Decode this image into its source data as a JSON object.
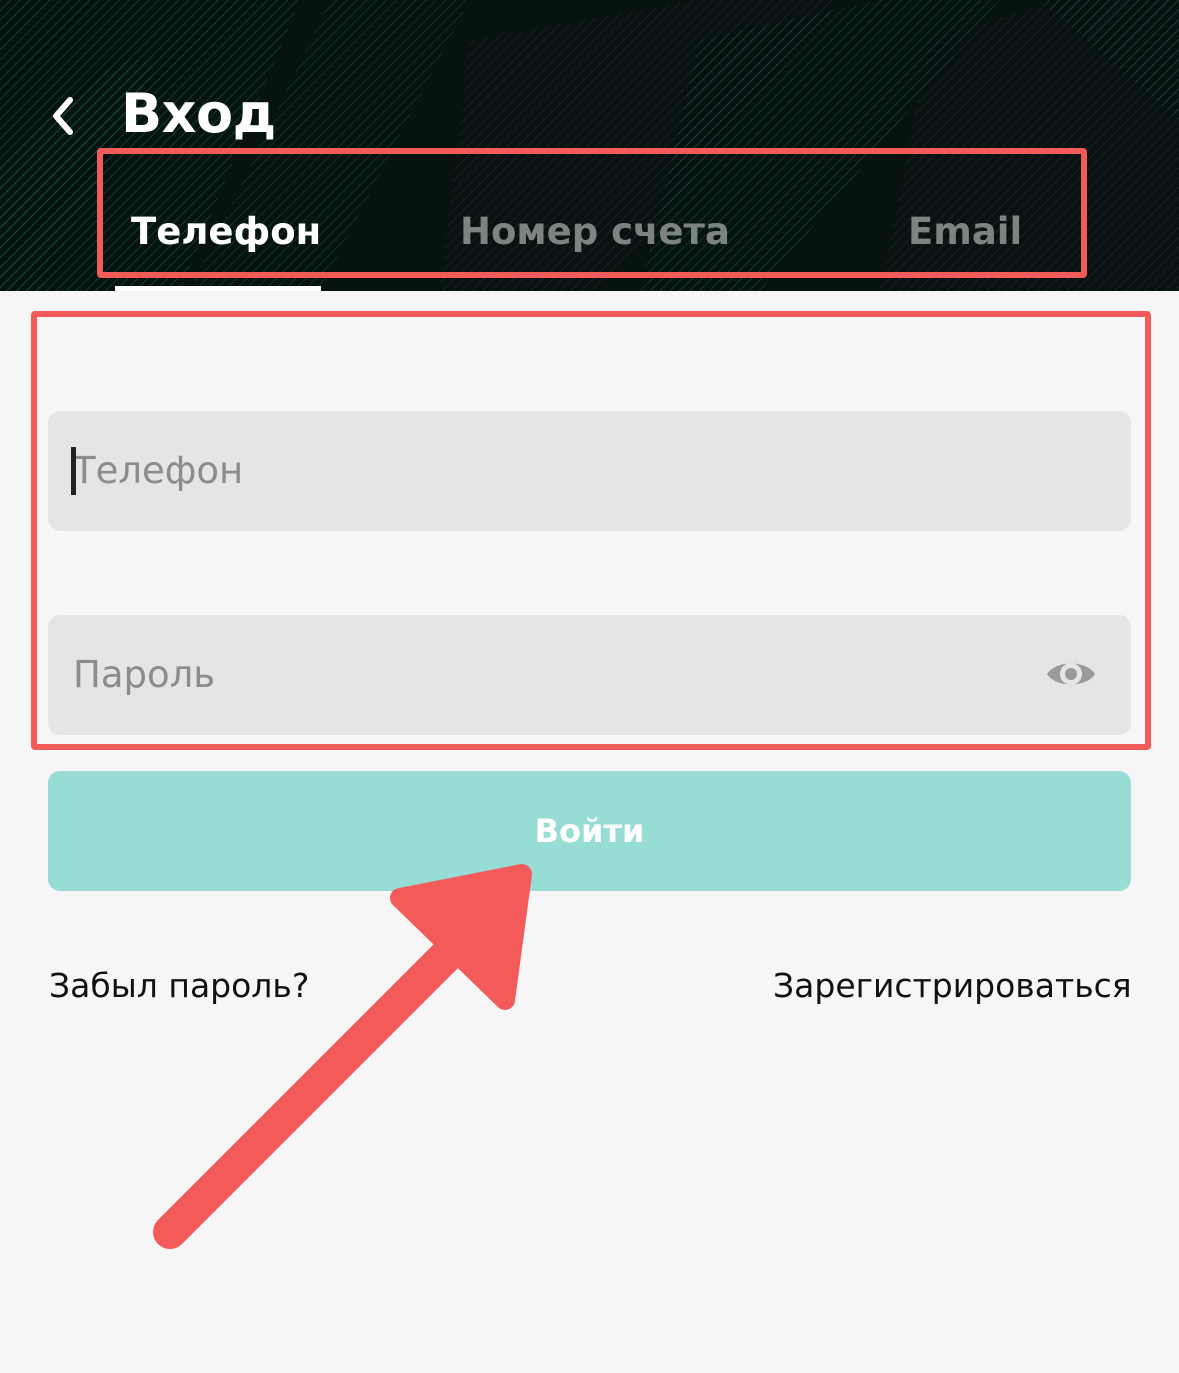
{
  "header": {
    "title": "Вход",
    "back_icon": "chevron-left-icon"
  },
  "tabs": [
    {
      "label": "Телефон",
      "active": true
    },
    {
      "label": "Номер счета",
      "active": false
    },
    {
      "label": "Email",
      "active": false
    }
  ],
  "form": {
    "phone_placeholder": "Телефон",
    "password_placeholder": "Пароль",
    "eye_icon": "eye-icon",
    "submit_label": "Войти"
  },
  "links": {
    "forgot": "Забыл пароль?",
    "register": "Зарегистрироваться"
  },
  "colors": {
    "header_bg": "#07130f",
    "accent_teal": "#97ddd5",
    "annotation_red": "#f25b5a"
  }
}
